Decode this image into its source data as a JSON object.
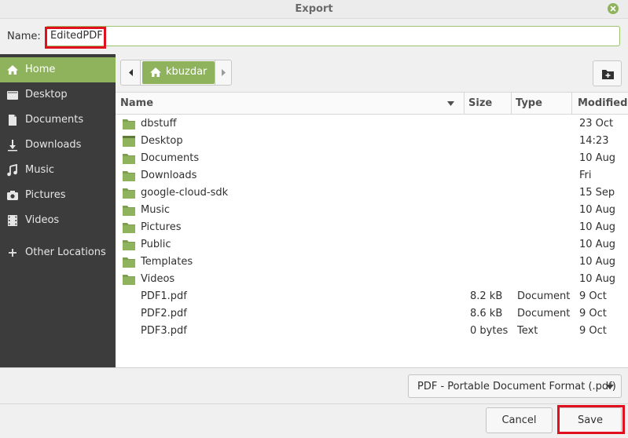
{
  "window": {
    "title": "Export"
  },
  "name_field": {
    "label": "Name:",
    "value": "EditedPDF"
  },
  "sidebar": {
    "items": [
      {
        "label": "Home",
        "icon": "home-icon",
        "active": true
      },
      {
        "label": "Desktop",
        "icon": "desktop-icon",
        "active": false
      },
      {
        "label": "Documents",
        "icon": "document-icon",
        "active": false
      },
      {
        "label": "Downloads",
        "icon": "download-icon",
        "active": false
      },
      {
        "label": "Music",
        "icon": "music-icon",
        "active": false
      },
      {
        "label": "Pictures",
        "icon": "camera-icon",
        "active": false
      },
      {
        "label": "Videos",
        "icon": "film-icon",
        "active": false
      },
      {
        "label": "Other Locations",
        "icon": "plus-icon",
        "active": false
      }
    ]
  },
  "pathbar": {
    "current": "kbuzdar"
  },
  "columns": {
    "name": "Name",
    "size": "Size",
    "type": "Type",
    "modified": "Modified"
  },
  "files": [
    {
      "name": "dbstuff",
      "size": "",
      "type": "",
      "modified": "23 Oct",
      "kind": "folder"
    },
    {
      "name": "Desktop",
      "size": "",
      "type": "",
      "modified": "14:23",
      "kind": "desktop"
    },
    {
      "name": "Documents",
      "size": "",
      "type": "",
      "modified": "10 Aug",
      "kind": "folder"
    },
    {
      "name": "Downloads",
      "size": "",
      "type": "",
      "modified": "Fri",
      "kind": "folder"
    },
    {
      "name": "google-cloud-sdk",
      "size": "",
      "type": "",
      "modified": "15 Sep",
      "kind": "folder"
    },
    {
      "name": "Music",
      "size": "",
      "type": "",
      "modified": "10 Aug",
      "kind": "folder"
    },
    {
      "name": "Pictures",
      "size": "",
      "type": "",
      "modified": "10 Aug",
      "kind": "folder"
    },
    {
      "name": "Public",
      "size": "",
      "type": "",
      "modified": "10 Aug",
      "kind": "folder"
    },
    {
      "name": "Templates",
      "size": "",
      "type": "",
      "modified": "10 Aug",
      "kind": "folder"
    },
    {
      "name": "Videos",
      "size": "",
      "type": "",
      "modified": "10 Aug",
      "kind": "folder"
    },
    {
      "name": "PDF1.pdf",
      "size": "8.2 kB",
      "type": "Document",
      "modified": "9 Oct",
      "kind": "file"
    },
    {
      "name": "PDF2.pdf",
      "size": "8.6 kB",
      "type": "Document",
      "modified": "9 Oct",
      "kind": "file"
    },
    {
      "name": "PDF3.pdf",
      "size": "0 bytes",
      "type": "Text",
      "modified": "9 Oct",
      "kind": "file"
    }
  ],
  "filter": {
    "selected": "PDF - Portable Document Format (.pdf)"
  },
  "buttons": {
    "cancel": "Cancel",
    "save": "Save"
  },
  "colors": {
    "accent": "#8fb35d",
    "sidebar_bg": "#3c3c3c",
    "highlight": "#e0101e"
  }
}
